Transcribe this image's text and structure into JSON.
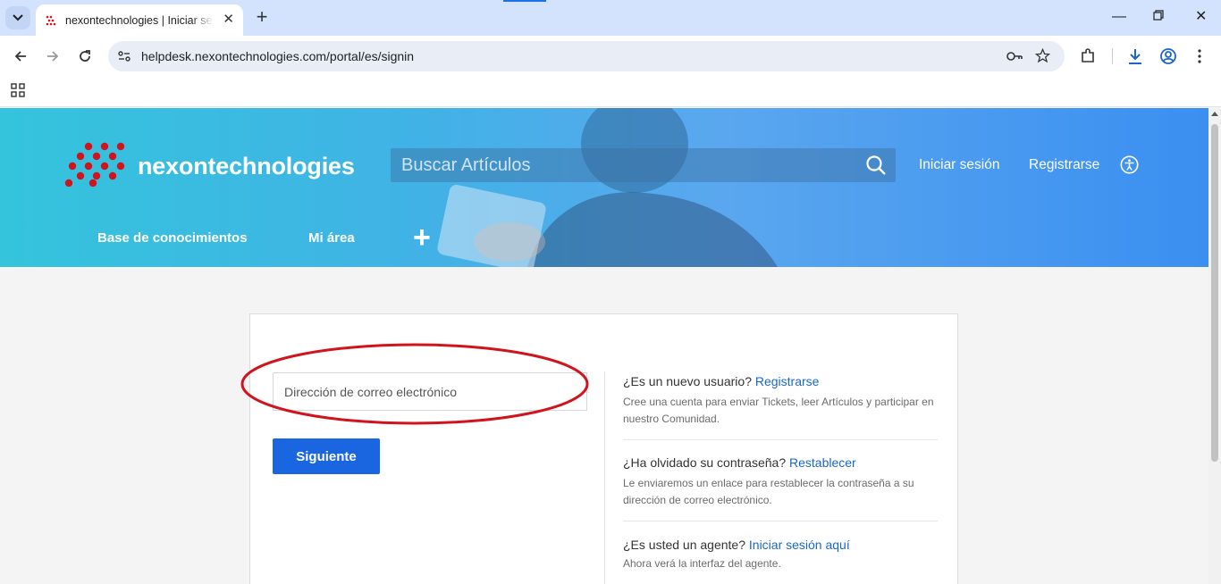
{
  "browser": {
    "tab_title": "nexontechnologies | Iniciar sesión",
    "url": "helpdesk.nexontechnologies.com/portal/es/signin"
  },
  "header": {
    "brand": "nexontechnologies",
    "search_placeholder": "Buscar Artículos",
    "login_link": "Iniciar sesión",
    "register_link": "Registrarse",
    "nav": [
      "Base de conocimientos",
      "Mi área"
    ],
    "colors": {
      "gradient_start": "#34c4dc",
      "gradient_end": "#3a8ff0",
      "logo_red": "#d0131c"
    }
  },
  "signin": {
    "email_placeholder": "Dirección de correo electrónico",
    "next_button": "Siguiente",
    "accent": "#1a66e0"
  },
  "side_info": [
    {
      "question": "¿Es un nuevo usuario?",
      "link": "Registrarse",
      "description": "Cree una cuenta para enviar Tickets, leer Artículos y participar en nuestro Comunidad."
    },
    {
      "question": "¿Ha olvidado su contraseña?",
      "link": "Restablecer",
      "description": "Le enviaremos un enlace para restablecer la contraseña a su dirección de correo electrónico."
    },
    {
      "question": "¿Es usted un agente?",
      "link": "Iniciar sesión aquí",
      "description": "Ahora verá la interfaz del agente."
    }
  ]
}
